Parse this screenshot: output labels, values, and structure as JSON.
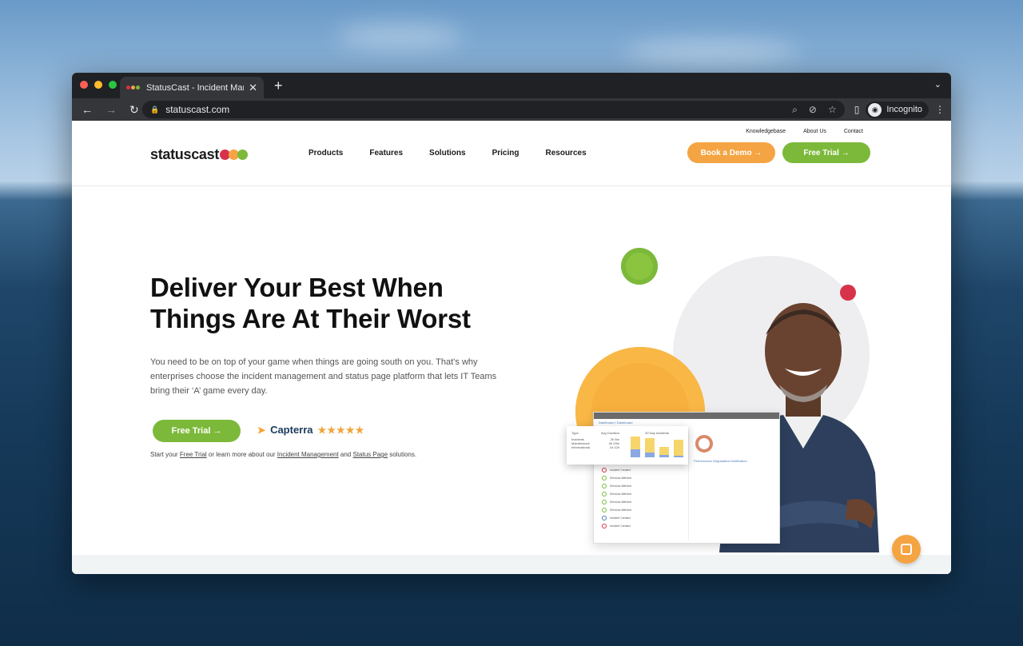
{
  "browser": {
    "tab_title": "StatusCast - Incident Managem",
    "url": "statuscast.com",
    "profile_label": "Incognito",
    "traffic_lights": [
      "#ff5f57",
      "#febc2e",
      "#28c840"
    ]
  },
  "site": {
    "brand": "statuscast",
    "brand_colors": [
      "#d6334a",
      "#f5a443",
      "#7cb93a"
    ],
    "utility_links": [
      "Knowledgebase",
      "About Us",
      "Contact"
    ],
    "nav": [
      "Products",
      "Features",
      "Solutions",
      "Pricing",
      "Resources"
    ],
    "book_demo": "Book a Demo →",
    "free_trial_header": "Free Trial →"
  },
  "hero": {
    "line1_pre": "Deliver Your ",
    "line1_hl": "Best",
    "line1_post": " When",
    "line2_pre": "Things Are At Their ",
    "line2_hl": "Worst",
    "body": "You need to be on top of your game when things are going south on you. That’s why enterprises choose the incident management and status page platform that lets IT Teams bring their ‘A’ game every day.",
    "cta": "Free Trial →",
    "capterra": "Capterra",
    "stars": "★★★★★",
    "sub_pre": "Start your ",
    "sub_link1": "Free Trial",
    "sub_mid": " or learn more about our ",
    "sub_link2": "Incident Management",
    "sub_and": " and ",
    "sub_link3": "Status Page",
    "sub_post": " solutions."
  },
  "dashboard": {
    "crumb": "Dashboard / Dashboard",
    "card_type": "Type",
    "card_avg": "Avg Duration",
    "card_chart_title": "30 Day Incidents",
    "card_rows": [
      {
        "label": "Incidents",
        "value": "2h 8m"
      },
      {
        "label": "Maintenance",
        "value": "3h 29m"
      },
      {
        "label": "Informational",
        "value": "1d 12h"
      }
    ],
    "bars": [
      {
        "yellow": 0.6,
        "blue": 0.4
      },
      {
        "yellow": 0.75,
        "blue": 0.25
      },
      {
        "yellow": 0.8,
        "blue": 0.2
      },
      {
        "yellow": 0.9,
        "blue": 0.1
      }
    ]
  },
  "colors": {
    "green": "#7cb93a",
    "orange": "#f5a443",
    "red": "#d6334a"
  }
}
